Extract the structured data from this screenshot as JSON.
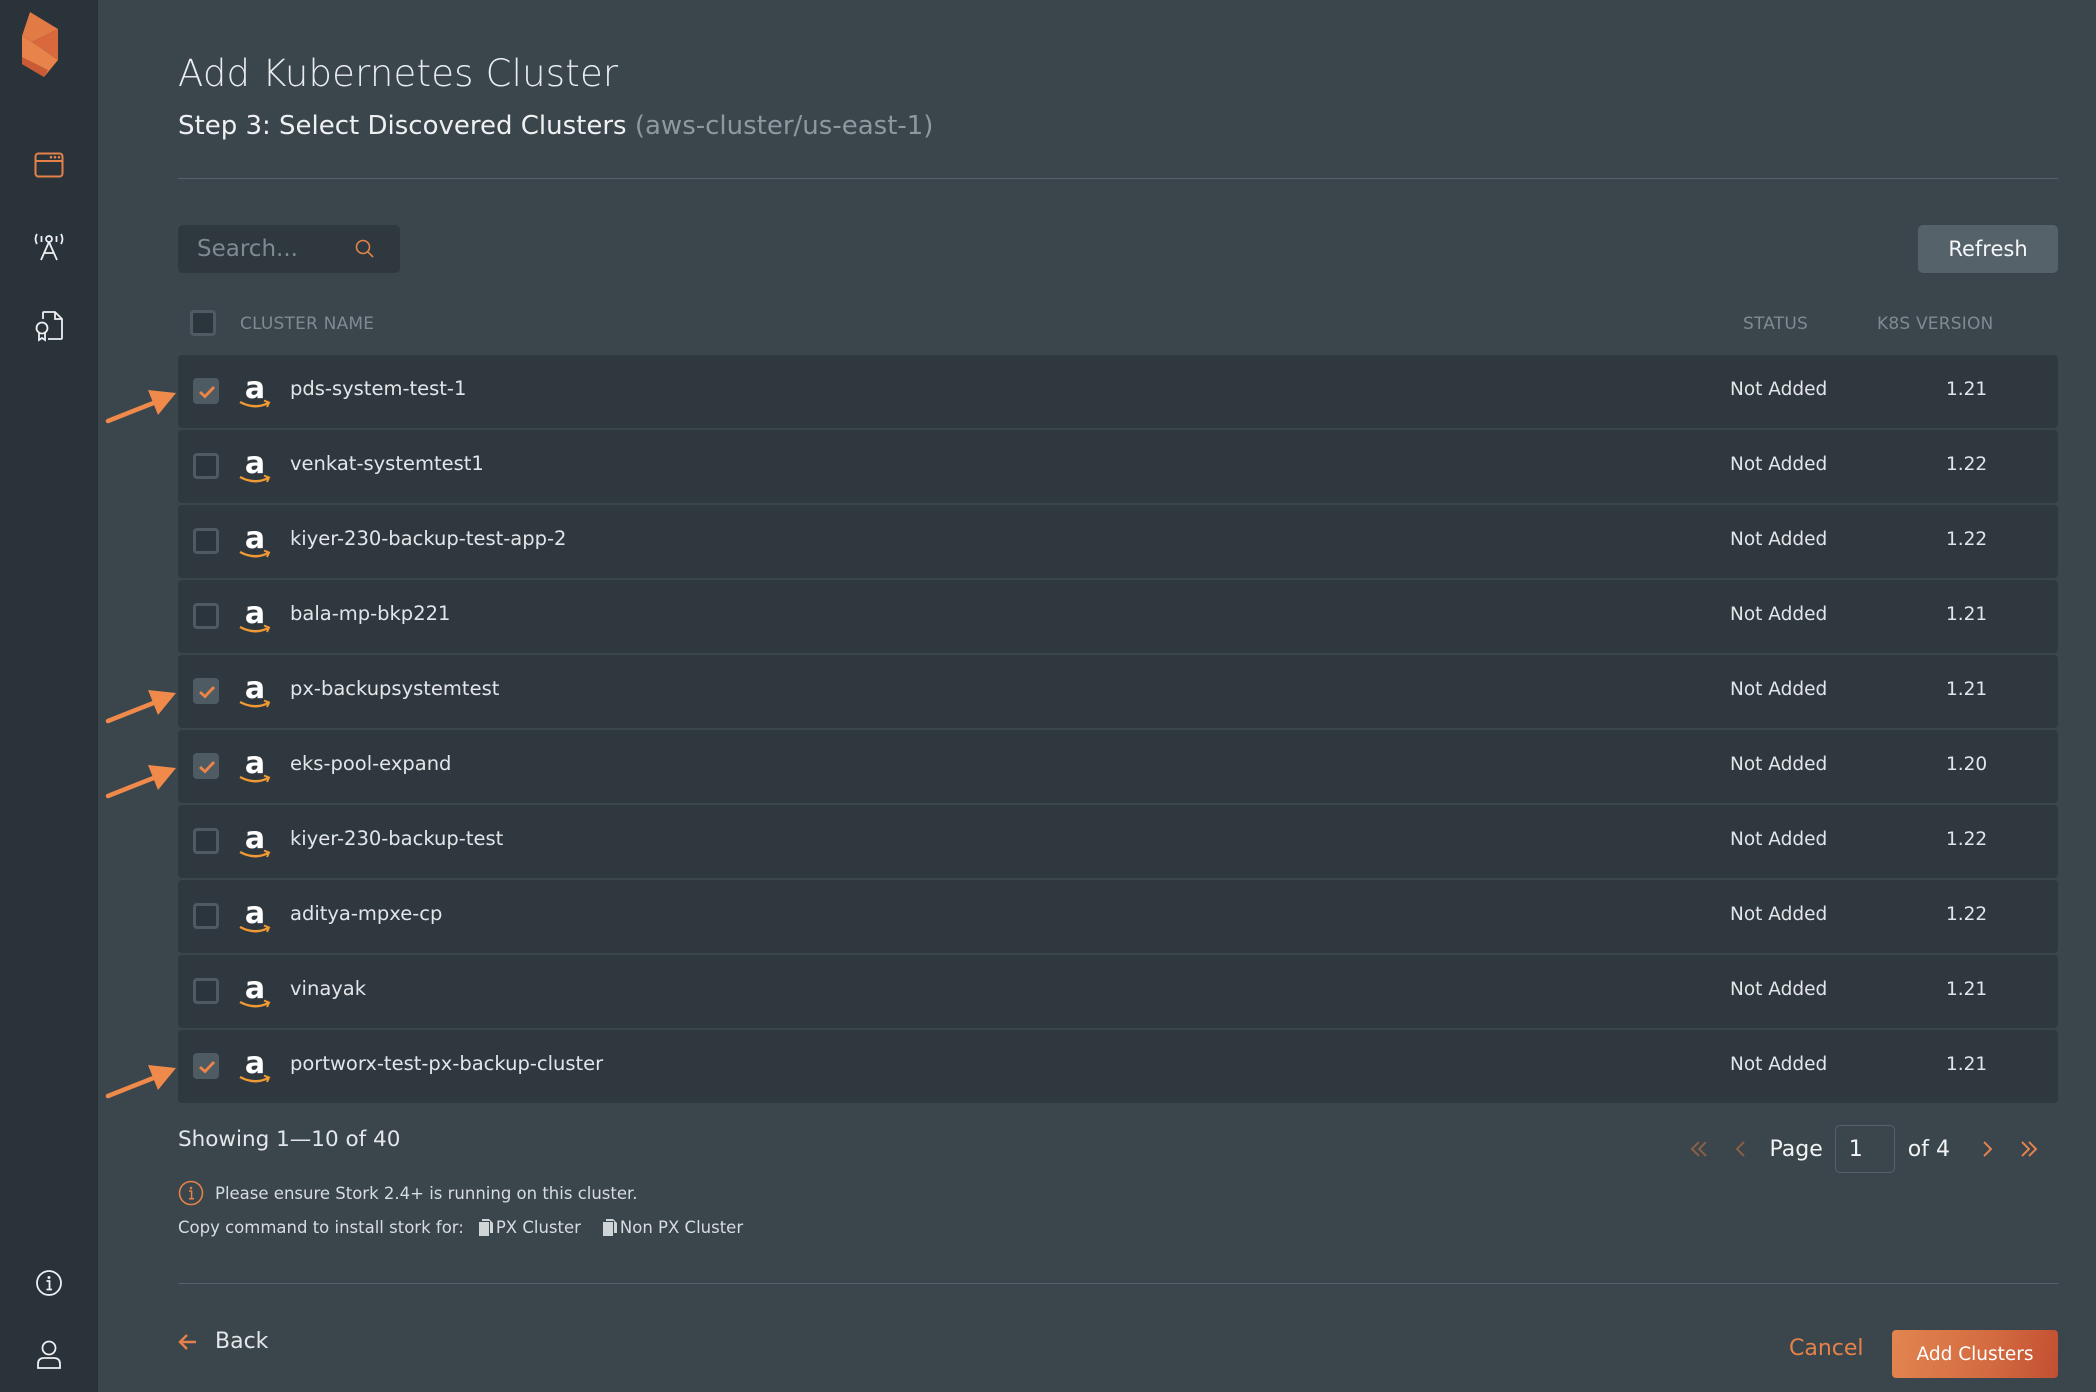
{
  "sidebar": {
    "logo": "portworx-logo",
    "items": [
      {
        "name": "applications",
        "icon": "browser-window-icon",
        "active": true
      },
      {
        "name": "clusters",
        "icon": "antenna-tower-icon",
        "active": false
      },
      {
        "name": "licenses",
        "icon": "certificate-document-icon",
        "active": false
      }
    ],
    "bottom_items": [
      {
        "name": "info",
        "icon": "info-circle-icon"
      },
      {
        "name": "user",
        "icon": "user-icon"
      }
    ]
  },
  "header": {
    "title": "Add Kubernetes Cluster",
    "subtitle": "Step 3: Select Discovered Clusters",
    "subtitle_context": "(aws-cluster/us-east-1)"
  },
  "toolbar": {
    "search_placeholder": "Search...",
    "search_value": "",
    "refresh_label": "Refresh"
  },
  "table": {
    "columns": {
      "name": "CLUSTER NAME",
      "status": "STATUS",
      "version": "K8S VERSION"
    },
    "select_all_checked": false,
    "rows": [
      {
        "name": "pds-system-test-1",
        "provider": "aws",
        "status": "Not Added",
        "version": "1.21",
        "checked": true,
        "annotated": true
      },
      {
        "name": "venkat-systemtest1",
        "provider": "aws",
        "status": "Not Added",
        "version": "1.22",
        "checked": false,
        "annotated": false
      },
      {
        "name": "kiyer-230-backup-test-app-2",
        "provider": "aws",
        "status": "Not Added",
        "version": "1.22",
        "checked": false,
        "annotated": false
      },
      {
        "name": "bala-mp-bkp221",
        "provider": "aws",
        "status": "Not Added",
        "version": "1.21",
        "checked": false,
        "annotated": false
      },
      {
        "name": "px-backupsystemtest",
        "provider": "aws",
        "status": "Not Added",
        "version": "1.21",
        "checked": true,
        "annotated": true
      },
      {
        "name": "eks-pool-expand",
        "provider": "aws",
        "status": "Not Added",
        "version": "1.20",
        "checked": true,
        "annotated": true
      },
      {
        "name": "kiyer-230-backup-test",
        "provider": "aws",
        "status": "Not Added",
        "version": "1.22",
        "checked": false,
        "annotated": false
      },
      {
        "name": "aditya-mpxe-cp",
        "provider": "aws",
        "status": "Not Added",
        "version": "1.22",
        "checked": false,
        "annotated": false
      },
      {
        "name": "vinayak",
        "provider": "aws",
        "status": "Not Added",
        "version": "1.21",
        "checked": false,
        "annotated": false
      },
      {
        "name": "portworx-test-px-backup-cluster",
        "provider": "aws",
        "status": "Not Added",
        "version": "1.21",
        "checked": true,
        "annotated": true
      }
    ]
  },
  "pagination": {
    "showing": "Showing 1—10 of 40",
    "page_label": "Page",
    "current_page": "1",
    "of_label": "of 4"
  },
  "notice": {
    "info_text": "Please ensure Stork 2.4+ is running on this cluster.",
    "copy_prefix": "Copy command to install stork for:",
    "copy_px": "PX Cluster",
    "copy_non_px": "Non PX Cluster"
  },
  "footer": {
    "back_label": "Back",
    "cancel_label": "Cancel",
    "add_label": "Add Clusters"
  },
  "colors": {
    "accent": "#e4824a",
    "sidebar_bg": "#2a333a",
    "page_bg": "#3b454c",
    "row_bg": "#2f383f",
    "annotation_arrow": "#f08a4b"
  }
}
